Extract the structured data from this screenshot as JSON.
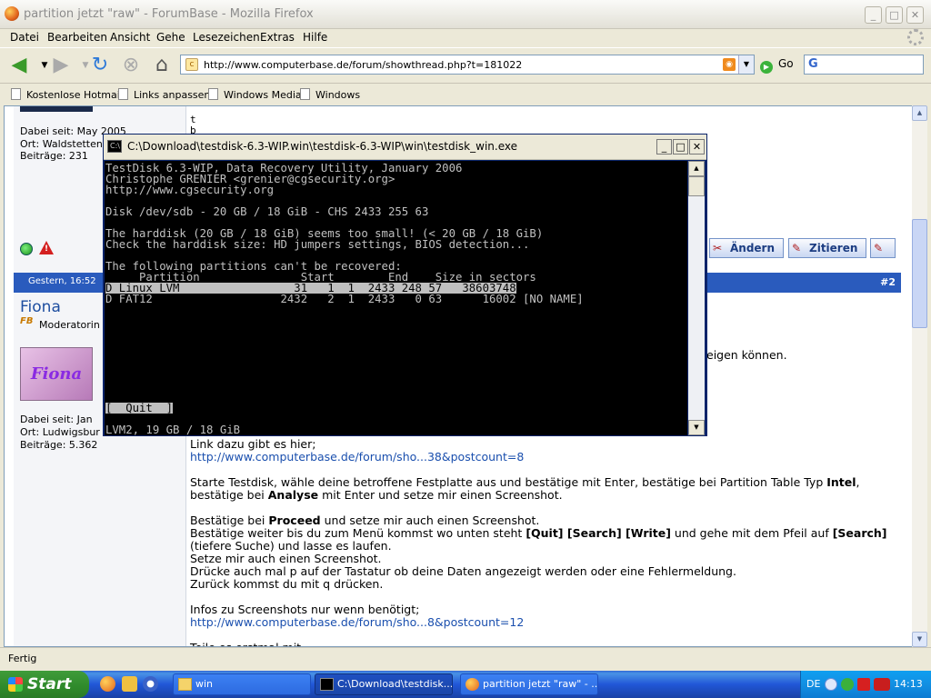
{
  "window": {
    "title": "partition jetzt \"raw\" - ForumBase - Mozilla Firefox"
  },
  "menu": [
    "Datei",
    "Bearbeiten",
    "Ansicht",
    "Gehe",
    "Lesezeichen",
    "Extras",
    "Hilfe"
  ],
  "nav": {
    "url": "http://www.computerbase.de/forum/showthread.php?t=181022",
    "go_label": "Go",
    "search_value": "G"
  },
  "bookmarks": [
    "Kostenlose Hotmail",
    "Links anpassen",
    "Windows Media",
    "Windows"
  ],
  "status": "Fertig",
  "forum": {
    "prev_user": {
      "joined": "Dabei seit: May 2005",
      "location": "Ort: Waldstetten",
      "posts": "Beiträge: 231"
    },
    "prev_post_letters": [
      "t",
      "b"
    ],
    "buttons": {
      "edit": "Ändern",
      "quote": "Zitieren"
    },
    "post2": {
      "date": "Gestern, 16:52",
      "number": "#2",
      "author": "Fiona",
      "role": "Moderatorin",
      "avatar_text": "Fiona",
      "joined": "Dabei seit: Jan",
      "location": "Ort: Ludwigsbur",
      "posts": "Beiträge: 5.362",
      "visible_fragment": "eigen können.",
      "lines": [
        {
          "type": "text",
          "text": "Link dazu gibt es hier;"
        },
        {
          "type": "link",
          "text": "http://www.computerbase.de/forum/sho...38&postcount=8"
        },
        {
          "type": "rich",
          "parts": [
            [
              "Starte Testdisk, wähle deine betroffene Festplatte aus und bestätige mit Enter, bestätige bei Partition Table Typ ",
              0
            ],
            [
              "Intel",
              1
            ],
            [
              ",",
              0
            ]
          ]
        },
        {
          "type": "rich",
          "parts": [
            [
              "bestätige bei ",
              0
            ],
            [
              "Analyse",
              1
            ],
            [
              " mit Enter und setze mir einen Screenshot.",
              0
            ]
          ]
        },
        {
          "type": "rich",
          "parts": [
            [
              "Bestätige bei ",
              0
            ],
            [
              "Proceed",
              1
            ],
            [
              " und setze mir auch einen Screenshot.",
              0
            ]
          ]
        },
        {
          "type": "rich",
          "parts": [
            [
              "Bestätige weiter bis du zum Menü kommst wo unten steht ",
              0
            ],
            [
              "[Quit] [Search] [Write]",
              1
            ],
            [
              " und gehe mit dem Pfeil auf ",
              0
            ],
            [
              "[Search]",
              1
            ]
          ]
        },
        {
          "type": "text",
          "text": "(tiefere Suche) und lasse es laufen."
        },
        {
          "type": "text",
          "text": "Setze mir auch einen Screenshot."
        },
        {
          "type": "text",
          "text": "Drücke auch mal p auf der Tastatur ob deine Daten angezeigt werden oder eine Fehlermeldung."
        },
        {
          "type": "text",
          "text": "Zurück kommst du mit q drücken."
        },
        {
          "type": "text",
          "text": "Infos zu Screenshots nur wenn benötigt;"
        },
        {
          "type": "link",
          "text": "http://www.computerbase.de/forum/sho...8&postcount=12"
        },
        {
          "type": "text",
          "text": "Teile es erstmal mit"
        }
      ]
    }
  },
  "console": {
    "title": "C:\\Download\\testdisk-6.3-WIP.win\\testdisk-6.3-WIP\\win\\testdisk_win.exe",
    "lines": [
      "TestDisk 6.3-WIP, Data Recovery Utility, January 2006",
      "Christophe GRENIER <grenier@cgsecurity.org>",
      "http://www.cgsecurity.org",
      "",
      "Disk /dev/sdb - 20 GB / 18 GiB - CHS 2433 255 63",
      "",
      "The harddisk (20 GB / 18 GiB) seems too small! (< 20 GB / 18 GiB)",
      "Check the harddisk size: HD jumpers settings, BIOS detection...",
      "",
      "The following partitions can't be recovered:",
      "     Partition               Start        End    Size in sectors",
      "D Linux LVM                 31   1  1  2433 248 57   38603748",
      "D FAT12                   2432   2  1  2433   0 63      16002 [NO NAME]"
    ],
    "quit": "[  Quit  ]",
    "footer": "LVM2, 19 GB / 18 GiB"
  },
  "taskbar": {
    "start": "Start",
    "tasks": [
      "win",
      "C:\\Download\\testdisk...",
      "partition jetzt \"raw\" - ..."
    ],
    "lang": "DE",
    "clock": "14:13"
  }
}
